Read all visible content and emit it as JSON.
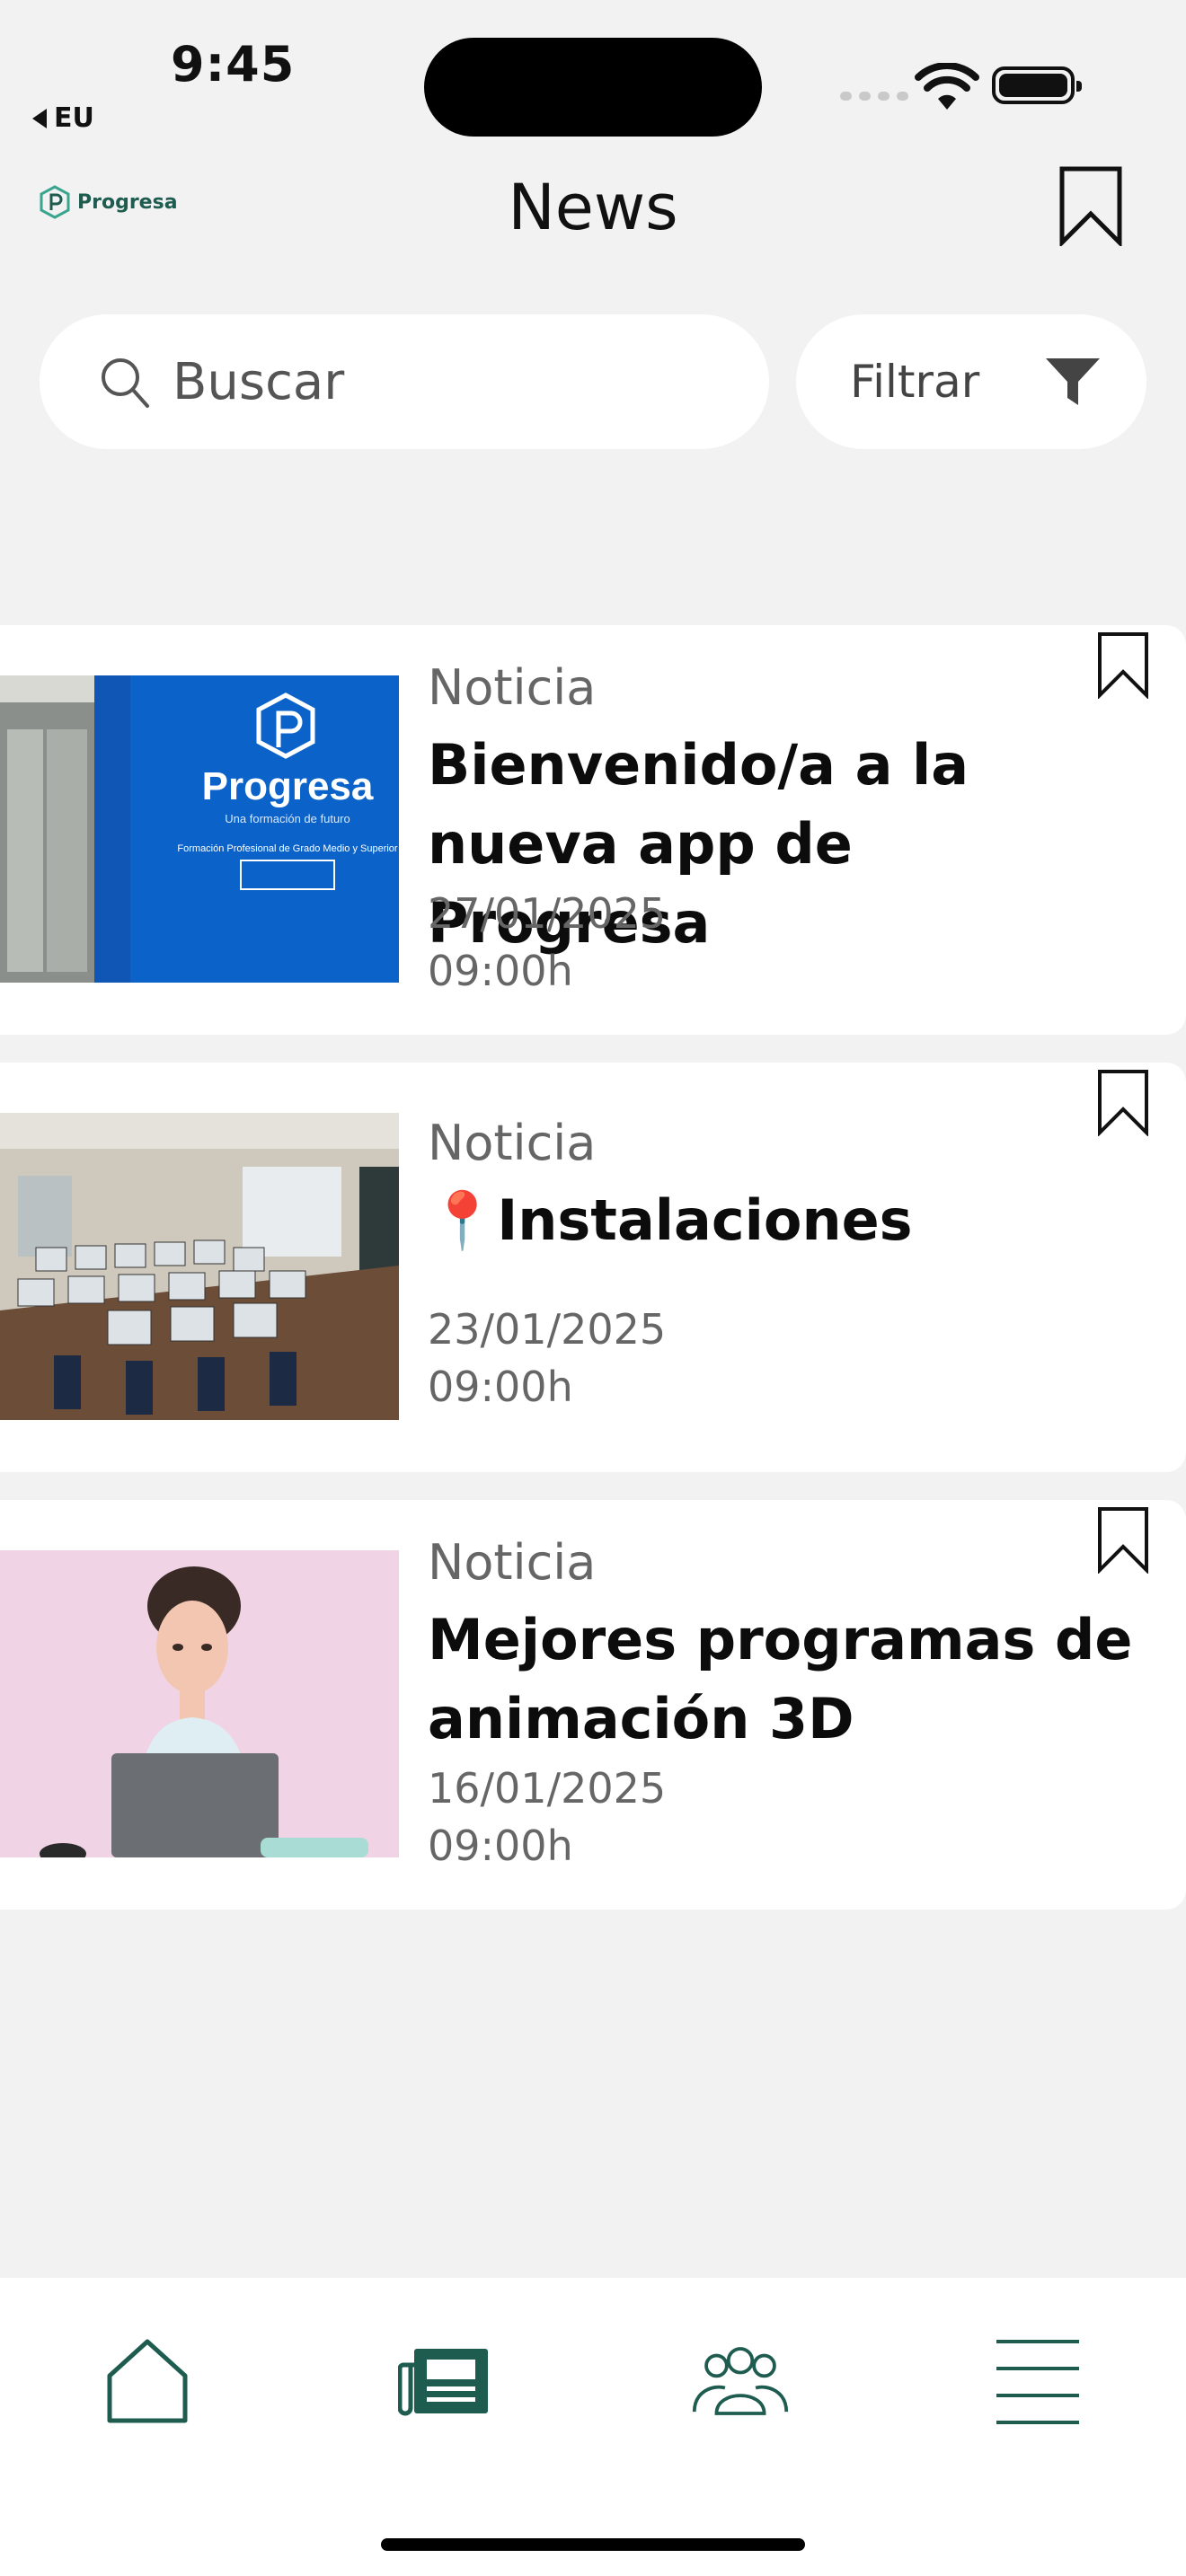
{
  "status_bar": {
    "time": "9:45",
    "back_app": "EU"
  },
  "header": {
    "logo_text": "Progresa",
    "title": "News",
    "bookmark_icon": "bookmark-outline-icon"
  },
  "search": {
    "placeholder": "Buscar",
    "value": "",
    "icon": "search-icon"
  },
  "filter": {
    "label": "Filtrar",
    "icon": "funnel-icon"
  },
  "news": [
    {
      "category": "Noticia",
      "title": "Bienvenido/a a la nueva app de Progresa",
      "date": "27/01/2025",
      "time": "09:00h",
      "thumbnail": "progresa-blue-wall-photo"
    },
    {
      "category": "Noticia",
      "title": "📍Instalaciones",
      "date": "23/01/2025",
      "time": "09:00h",
      "thumbnail": "computer-classroom-photo"
    },
    {
      "category": "Noticia",
      "title": "Mejores programas de animación 3D",
      "date": "16/01/2025",
      "time": "09:00h",
      "thumbnail": "3d-character-laptop-illustration"
    }
  ],
  "tab_bar": {
    "items": [
      {
        "icon": "home-icon"
      },
      {
        "icon": "newspaper-icon",
        "active": true
      },
      {
        "icon": "community-icon"
      },
      {
        "icon": "menu-icon"
      }
    ]
  },
  "colors": {
    "brand": "#1f5c50",
    "brand_light": "#3aa58e",
    "background": "#f2f2f2",
    "card": "#ffffff"
  }
}
